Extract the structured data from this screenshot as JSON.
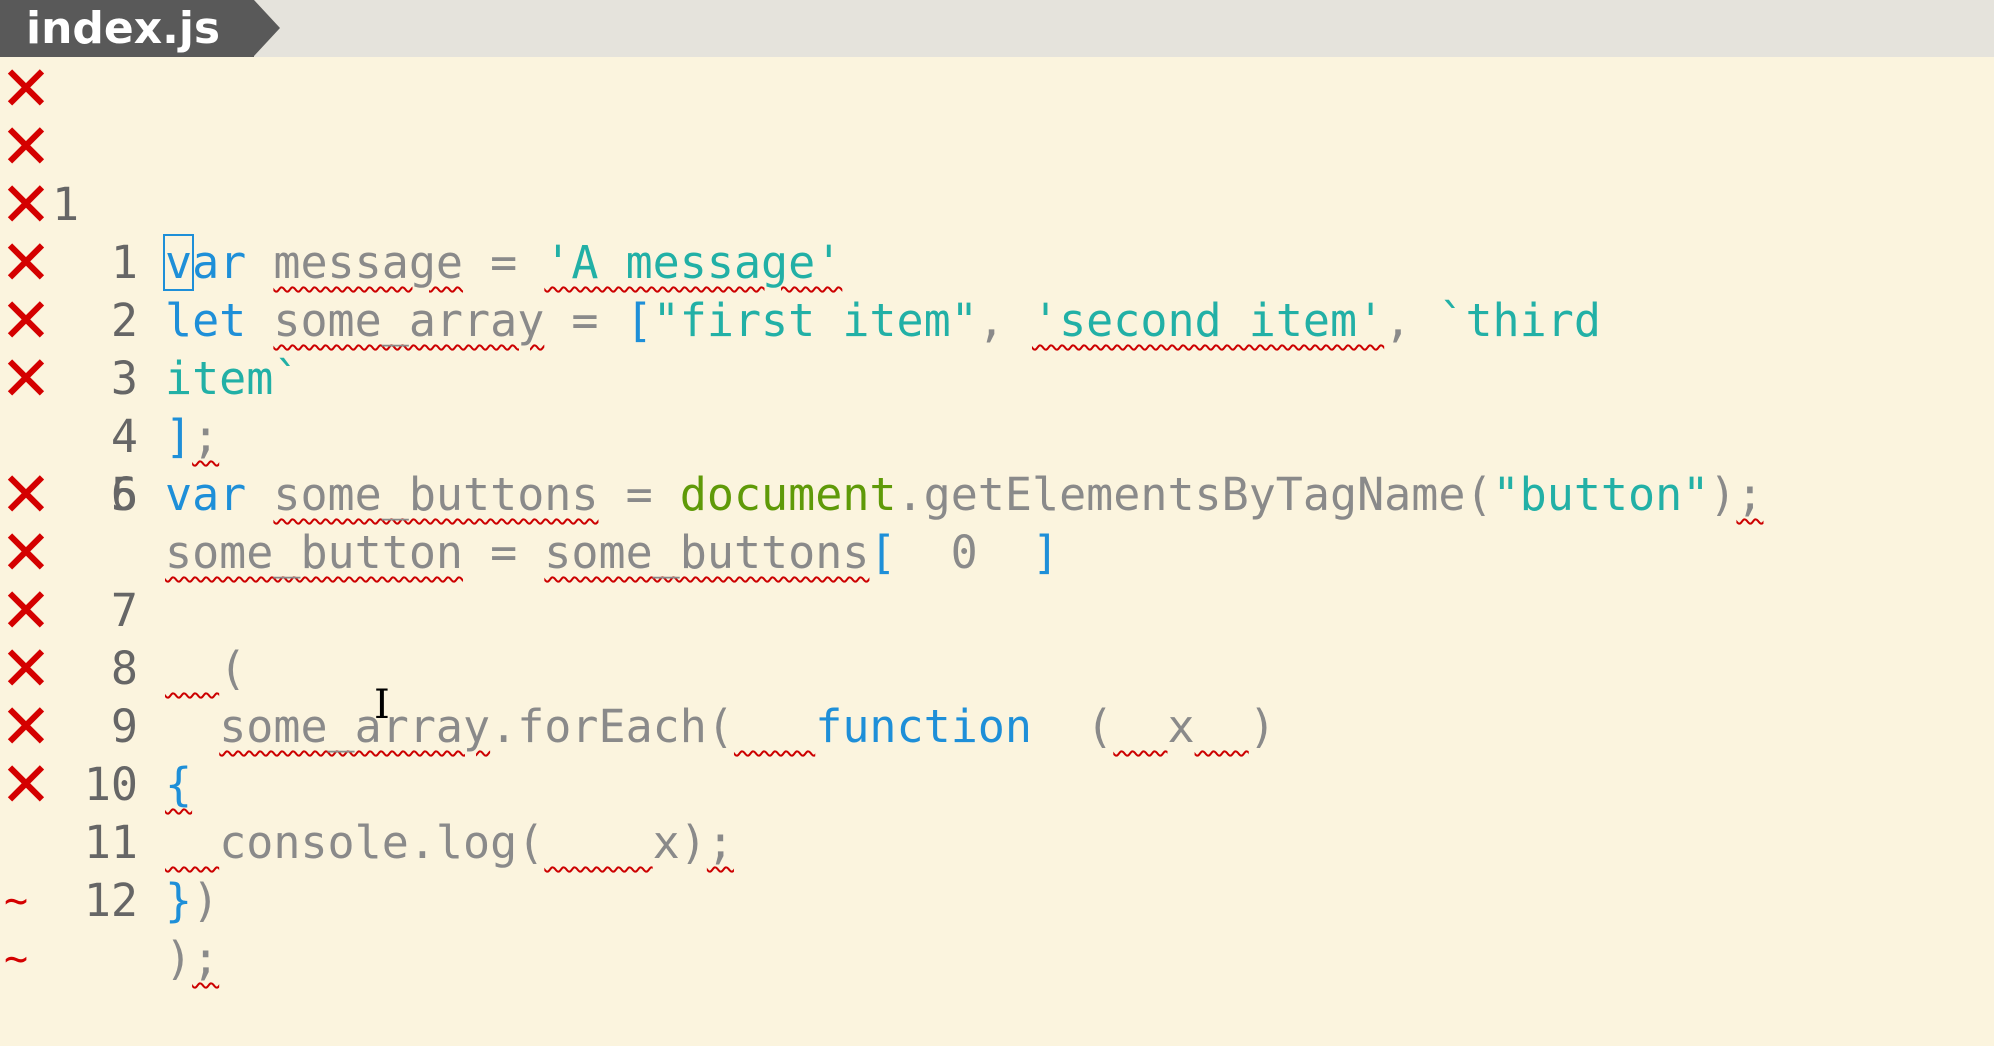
{
  "tab": {
    "filename": "index.js"
  },
  "gutter": {
    "error_icon": "error-x-icon",
    "current_line_number": "1",
    "line_numbers": [
      "1",
      "2",
      "3",
      "4",
      "5",
      "6",
      "7",
      "8",
      "9",
      "10",
      "11",
      "12"
    ]
  },
  "code": {
    "l0": [
      "v",
      "ar",
      " ",
      "message",
      " = ",
      "'A message'"
    ],
    "l1": [
      "let",
      " ",
      "some_array",
      " = ",
      "[",
      "\"first item\"",
      ", ",
      "'second item'",
      ", ",
      "`third"
    ],
    "l2": [
      "item`"
    ],
    "l3": [
      "]",
      ";"
    ],
    "l4": [
      "var",
      " ",
      "some_buttons",
      " = ",
      "document",
      ".getElementsByTagName(",
      "\"button\"",
      ")",
      ";"
    ],
    "l5": [
      "some_button",
      " = ",
      "some_buttons",
      "[",
      "  0  ",
      "]"
    ],
    "l7": [
      "  ",
      "("
    ],
    "l8": [
      "  ",
      "some_array",
      ".forEach(",
      "   ",
      "function",
      "  (",
      "  ",
      "x",
      "  ",
      ")"
    ],
    "l9": [
      "{"
    ],
    "l10": [
      "  ",
      "console.log(",
      "    ",
      "x)",
      ";"
    ],
    "l11": [
      "}",
      ")"
    ],
    "l12": [
      ")",
      ";"
    ]
  },
  "end_of_buffer": [
    "~",
    "~"
  ],
  "colors": {
    "background": "#fbf4de",
    "keyword": "#1e8fd8",
    "string": "#22b0a6",
    "global": "#5f9a08",
    "error": "#d40000"
  }
}
